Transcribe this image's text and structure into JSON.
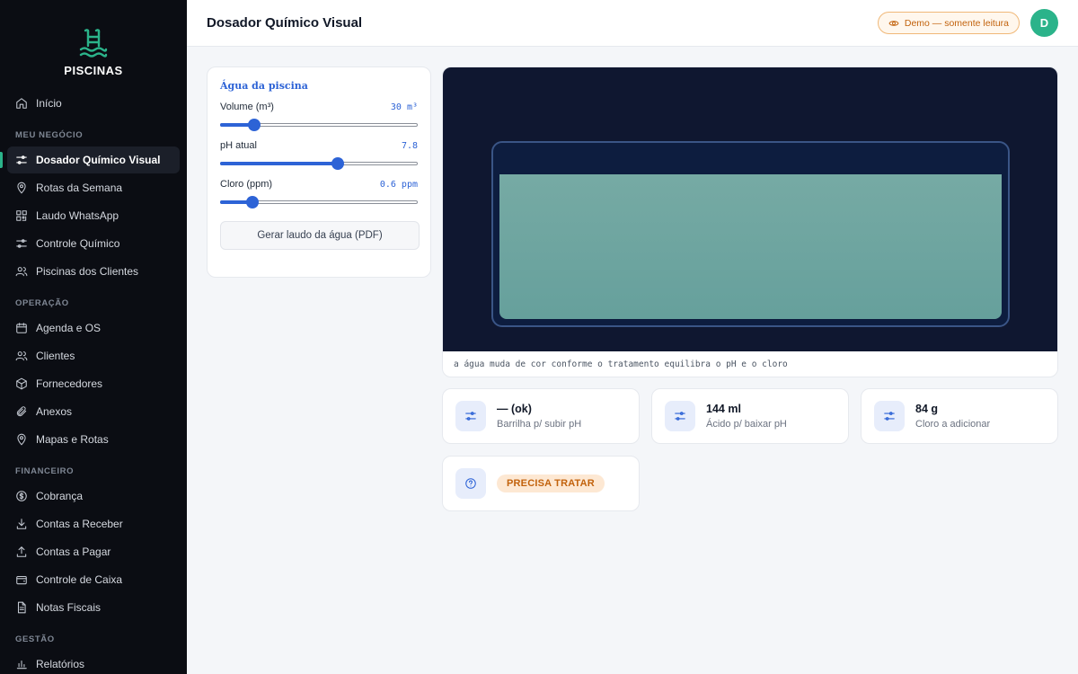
{
  "brand": {
    "name": "PISCINAS"
  },
  "sidebar": {
    "top_items": [
      {
        "label": "Início",
        "icon": "home-icon"
      }
    ],
    "sections": [
      {
        "title": "MEU NEGÓCIO",
        "items": [
          {
            "label": "Dosador Químico Visual",
            "icon": "sliders-icon",
            "active": true
          },
          {
            "label": "Rotas da Semana",
            "icon": "map-pin-icon"
          },
          {
            "label": "Laudo WhatsApp",
            "icon": "qr-code-icon"
          },
          {
            "label": "Controle Químico",
            "icon": "sliders-icon"
          },
          {
            "label": "Piscinas dos Clientes",
            "icon": "users-icon"
          }
        ]
      },
      {
        "title": "OPERAÇÃO",
        "items": [
          {
            "label": "Agenda e OS",
            "icon": "calendar-icon"
          },
          {
            "label": "Clientes",
            "icon": "users-icon"
          },
          {
            "label": "Fornecedores",
            "icon": "package-icon"
          },
          {
            "label": "Anexos",
            "icon": "paperclip-icon"
          },
          {
            "label": "Mapas e Rotas",
            "icon": "map-pin-icon"
          }
        ]
      },
      {
        "title": "FINANCEIRO",
        "items": [
          {
            "label": "Cobrança",
            "icon": "dollar-circle-icon"
          },
          {
            "label": "Contas a Receber",
            "icon": "download-icon"
          },
          {
            "label": "Contas a Pagar",
            "icon": "upload-icon"
          },
          {
            "label": "Controle de Caixa",
            "icon": "wallet-icon"
          },
          {
            "label": "Notas Fiscais",
            "icon": "file-text-icon"
          }
        ]
      },
      {
        "title": "GESTÃO",
        "items": [
          {
            "label": "Relatórios",
            "icon": "bar-chart-icon"
          }
        ]
      }
    ]
  },
  "header": {
    "title": "Dosador Químico Visual",
    "demo_badge": "Demo — somente leitura",
    "avatar_initial": "D"
  },
  "panel": {
    "title": "Água da piscina",
    "sliders": [
      {
        "label": "Volume (m³)",
        "value_text": "30 m³",
        "fraction": 0.15
      },
      {
        "label": "pH atual",
        "value_text": "7.8",
        "fraction": 0.6
      },
      {
        "label": "Cloro (ppm)",
        "value_text": "0.6 ppm",
        "fraction": 0.14
      }
    ],
    "pdf_button": "Gerar laudo da água (PDF)"
  },
  "visual": {
    "caption": "a água muda de cor conforme o tratamento equilibra o pH e o cloro",
    "water_color": "#6fa6a1",
    "stage_color": "#0f1730"
  },
  "stats": [
    {
      "value": "— (ok)",
      "label": "Barrilha p/ subir pH",
      "icon": "sliders-icon"
    },
    {
      "value": "144 ml",
      "label": "Ácido p/ baixar pH",
      "icon": "sliders-icon"
    },
    {
      "value": "84 g",
      "label": "Cloro a adicionar",
      "icon": "sliders-icon"
    }
  ],
  "status": {
    "label": "PRECISA TRATAR",
    "icon": "help-circle-icon"
  },
  "colors": {
    "accent": "#2d63d6",
    "brand": "#2bb38a",
    "warning": "#c2620c"
  }
}
